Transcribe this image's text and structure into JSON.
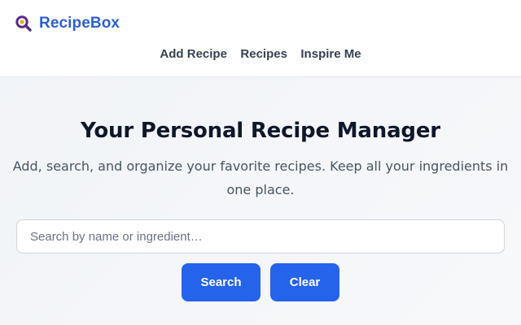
{
  "header": {
    "brand_name": "RecipeBox",
    "brand_icon": "magnifier-icon",
    "brand_color": "#2f5fd0",
    "nav": [
      {
        "label": "Add Recipe"
      },
      {
        "label": "Recipes"
      },
      {
        "label": "Inspire Me"
      }
    ]
  },
  "hero": {
    "title": "Your Personal Recipe Manager",
    "subtitle": "Add, search, and organize your favorite recipes. Keep all your ingredients in one place."
  },
  "search": {
    "placeholder": "Search by name or ingredient…",
    "value": "",
    "search_label": "Search",
    "clear_label": "Clear",
    "button_color": "#2563eb"
  }
}
